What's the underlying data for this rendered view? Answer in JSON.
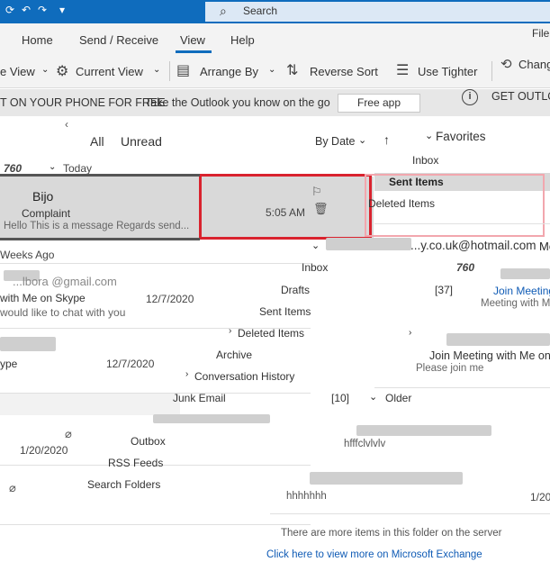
{
  "titlebar": {
    "search_placeholder": "Search",
    "file_label": "File"
  },
  "ribbon_tabs": [
    "Home",
    "Send / Receive",
    "View",
    "Help"
  ],
  "ribbon_commands": {
    "change_view": "e View",
    "current_view": "Current View",
    "arrange_by": "Arrange By",
    "reverse_sort": "Reverse Sort",
    "use_tighter": "Use Tighter",
    "change": "Chang"
  },
  "banner": {
    "promo": "T ON YOUR PHONE FOR FREE",
    "tagline": "Take the Outlook you know on the go",
    "free_app": "Free app",
    "get_outlook": "GET OUTLOO"
  },
  "list": {
    "filter_all": "All",
    "filter_unread": "Unread",
    "sort_by": "By Date",
    "groups": {
      "today": "Today",
      "weeks_ago": "Weeks Ago",
      "count_today": "760"
    },
    "selected_message": {
      "sender": "Bijo",
      "subject": "Complaint",
      "time": "5:05 AM",
      "preview": "Hello  This is a message  Regards  send..."
    },
    "messages": [
      {
        "sender": "...lbora @gmail.com",
        "subject": "with Me on Skype",
        "date": "12/7/2020",
        "preview": "would like to chat with you"
      },
      {
        "sender": "",
        "subject": "ype",
        "date": "12/7/2020",
        "preview": ""
      },
      {
        "sender": "",
        "subject": "",
        "date": "1/20/2020",
        "preview": ""
      }
    ]
  },
  "folder_pane": {
    "favorites": "Favorites",
    "fav_items": [
      "Inbox",
      "Sent Items",
      "Deleted Items"
    ],
    "account": "...y.co.uk@hotmail.com",
    "count_760": "760",
    "drafts_count": "[37]",
    "junk_count": "[10]",
    "items": [
      "Inbox",
      "Drafts",
      "Sent Items",
      "Deleted Items",
      "Archive",
      "Conversation History",
      "Junk Email",
      "Outbox",
      "RSS Feeds",
      "Search Folders"
    ],
    "older": "Older"
  },
  "right_column": {
    "mount": "Mount",
    "join_meeting_1": "Join Meeting",
    "meeting_with": "Meeting with M",
    "join_meeting_skype": "Join Meeting with Me on",
    "please_join": "Please join me",
    "hfff": "hfffclvlvlv",
    "hhh": "hhhhhhh",
    "date_partial": "1/20",
    "more_items": "There are more items in this folder on the server",
    "click_here": "Click here to view more on Microsoft Exchange"
  },
  "icons": [
    "search-icon",
    "undo-icon",
    "redo-icon",
    "change-view-icon",
    "current-view-icon",
    "arrange-by-icon",
    "reverse-sort-icon",
    "use-tighter-icon",
    "info-icon",
    "delete-icon",
    "flag-icon",
    "chevron-down-icon"
  ]
}
